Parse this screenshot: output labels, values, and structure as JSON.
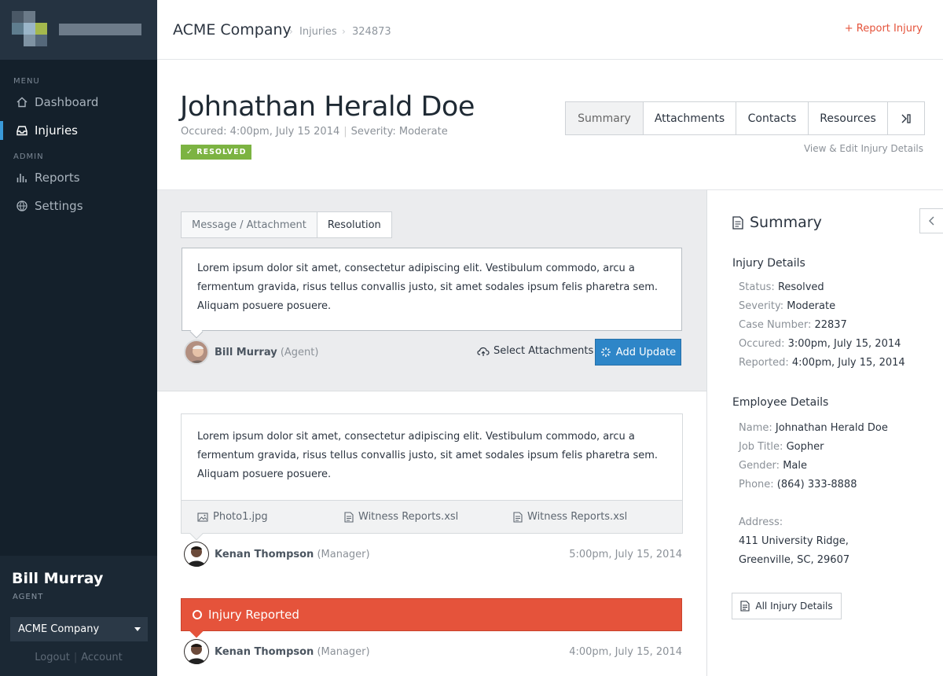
{
  "topbar": {
    "company": "ACME Company",
    "crumb_1": "Injuries",
    "crumb_2": "324873",
    "report_label": "+ Report Injury"
  },
  "sidebar": {
    "menu_header": "MENU",
    "admin_header": "ADMIN",
    "items": [
      {
        "label": "Dashboard",
        "icon": "home-icon"
      },
      {
        "label": "Injuries",
        "icon": "inbox-icon",
        "active": true
      },
      {
        "label": "Reports",
        "icon": "bar-chart-icon"
      },
      {
        "label": "Settings",
        "icon": "globe-icon"
      }
    ],
    "user_name": "Bill Murray",
    "user_role": "AGENT",
    "company_select": "ACME Company",
    "logout": "Logout",
    "account": "Account"
  },
  "header": {
    "name": "Johnathan Herald Doe",
    "occured": "Occured: 4:00pm, July 15 2014",
    "severity": "Severity: Moderate",
    "status_badge": "✓ RESOLVED",
    "tabs": [
      "Summary",
      "Attachments",
      "Contacts",
      "Resources"
    ],
    "view_edit": "View & Edit Injury Details"
  },
  "composer": {
    "tabs": [
      "Message / Attachment",
      "Resolution"
    ],
    "text": "Lorem ipsum dolor sit amet, consectetur adipiscing elit. Vestibulum commodo, arcu a fermentum gravida, risus tellus convallis justo, sit amet sodales ipsum felis pharetra sem. Aliquam posuere posuere.",
    "author_name": "Bill Murray",
    "author_role": "(Agent)",
    "select_attachments": "Select Attachments",
    "add_update": "Add Update"
  },
  "feed": {
    "message": {
      "text": "Lorem ipsum dolor sit amet, consectetur adipiscing elit. Vestibulum commodo, arcu a fermentum gravida, risus tellus convallis justo, sit amet sodales ipsum felis pharetra sem. Aliquam posuere posuere.",
      "files": [
        "Photo1.jpg",
        "Witness Reports.xsl",
        "Witness Reports.xsl"
      ],
      "author_name": "Kenan Thompson",
      "author_role": "(Manager)",
      "time": "5:00pm, July 15, 2014"
    },
    "event": {
      "label": "Injury Reported",
      "author_name": "Kenan Thompson",
      "author_role": "(Manager)",
      "time": "4:00pm, July 15, 2014"
    }
  },
  "summary": {
    "title": "Summary",
    "injury_header": "Injury Details",
    "injury": [
      {
        "k": "Status:",
        "v": "Resolved"
      },
      {
        "k": "Severity:",
        "v": "Moderate"
      },
      {
        "k": "Case Number:",
        "v": "22837"
      },
      {
        "k": "Occured:",
        "v": "3:00pm, July 15, 2014"
      },
      {
        "k": "Reported:",
        "v": "4:00pm, July 15, 2014"
      }
    ],
    "employee_header": "Employee Details",
    "employee": [
      {
        "k": "Name:",
        "v": "Johnathan Herald Doe"
      },
      {
        "k": "Job Title:",
        "v": "Gopher"
      },
      {
        "k": "Gender:",
        "v": "Male"
      },
      {
        "k": "Phone:",
        "v": "(864) 333-8888"
      }
    ],
    "address_label": "Address:",
    "address_line1": "411 University Ridge,",
    "address_line2": "Greenville, SC, 29607",
    "all_details": "All Injury Details"
  },
  "colors": {
    "accent": "#2e86c8",
    "danger": "#e5533b",
    "success": "#7cb342",
    "sidebar": "#14202b"
  }
}
